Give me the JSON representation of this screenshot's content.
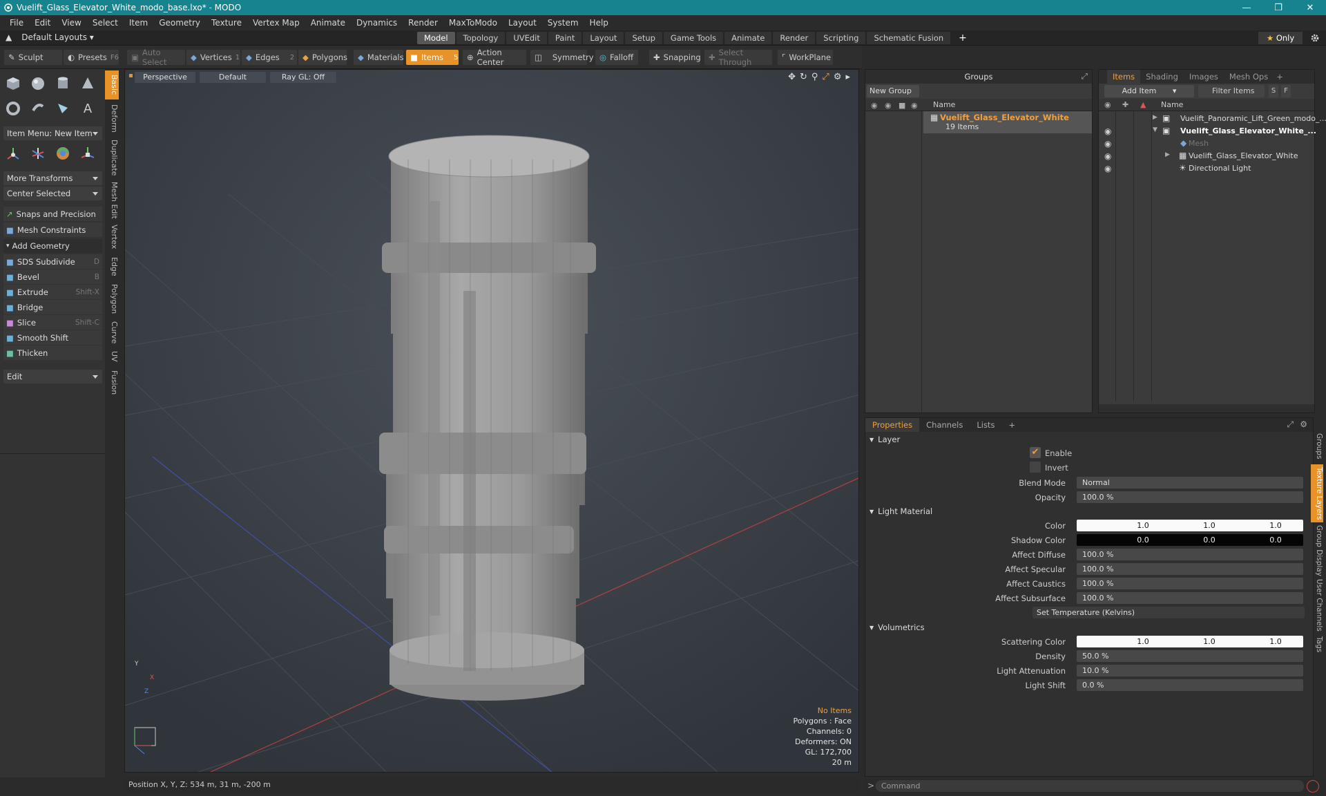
{
  "window": {
    "title": "Vuelift_Glass_Elevator_White_modo_base.lxo* - MODO"
  },
  "menu": [
    "File",
    "Edit",
    "View",
    "Select",
    "Item",
    "Geometry",
    "Texture",
    "Vertex Map",
    "Animate",
    "Dynamics",
    "Render",
    "MaxToModo",
    "Layout",
    "System",
    "Help"
  ],
  "layout": {
    "default_layouts": "Default Layouts",
    "tabs": [
      "Model",
      "Topology",
      "UVEdit",
      "Paint",
      "Layout",
      "Setup",
      "Game Tools",
      "Animate",
      "Render",
      "Scripting",
      "Schematic Fusion"
    ],
    "active_tab": "Model",
    "add": "+",
    "only": "Only"
  },
  "toolbar": {
    "sculpt": "Sculpt",
    "presets": "Presets",
    "presets_key": "F6",
    "auto_select": "Auto Select",
    "vertices": "Vertices",
    "vertices_key": "1",
    "edges": "Edges",
    "edges_key": "2",
    "polygons": "Polygons",
    "materials": "Materials",
    "items": "Items",
    "items_key": "5",
    "action_center": "Action Center",
    "symmetry": "Symmetry",
    "falloff": "Falloff",
    "snapping": "Snapping",
    "select_through": "Select Through",
    "workplane": "WorkPlane"
  },
  "toolbox": {
    "item_menu": "Item Menu: New Item",
    "more_transforms": "More Transforms",
    "center_selected": "Center Selected",
    "snaps": "Snaps and Precision",
    "mesh_constraints": "Mesh Constraints",
    "add_geometry": "Add Geometry",
    "tools": [
      {
        "label": "SDS Subdivide",
        "key": "D"
      },
      {
        "label": "Bevel",
        "key": "B"
      },
      {
        "label": "Extrude",
        "key": "Shift-X"
      },
      {
        "label": "Bridge",
        "key": ""
      },
      {
        "label": "Slice",
        "key": "Shift-C"
      },
      {
        "label": "Smooth Shift",
        "key": ""
      },
      {
        "label": "Thicken",
        "key": ""
      }
    ],
    "edit": "Edit",
    "vtabs": [
      "Basic",
      "Deform",
      "Duplicate",
      "Mesh Edit",
      "Vertex",
      "Edge",
      "Polygon",
      "Curve",
      "UV",
      "Fusion"
    ]
  },
  "viewport": {
    "perspective": "Perspective",
    "default": "Default",
    "raygl": "Ray GL: Off",
    "info": {
      "no_items": "No Items",
      "polygons": "Polygons : Face",
      "channels": "Channels: 0",
      "deformers": "Deformers: ON",
      "gl": "GL: 172,700",
      "scale": "20 m"
    },
    "axes": {
      "y": "Y",
      "x": "X",
      "z": "Z"
    }
  },
  "status": {
    "position": "Position X, Y, Z:  534 m, 31 m, -200 m"
  },
  "groups": {
    "title": "Groups",
    "new_group": "New Group",
    "name_col": "Name",
    "row_name": "Vuelift_Glass_Elevator_White",
    "row_count": "19 Items"
  },
  "items": {
    "tabs": [
      "Items",
      "Shading",
      "Images",
      "Mesh Ops"
    ],
    "add_tab": "+",
    "add_item": "Add Item",
    "filter": "Filter Items",
    "s": "S",
    "f": "F",
    "name_col": "Name",
    "rows": [
      "Vuelift_Panoramic_Lift_Green_modo_...",
      "Vuelift_Glass_Elevator_White_...",
      "Mesh",
      "Vuelift_Glass_Elevator_White",
      "Directional Light"
    ]
  },
  "properties": {
    "tabs": [
      "Properties",
      "Channels",
      "Lists"
    ],
    "add_tab": "+",
    "layer": "Layer",
    "enable": "Enable",
    "invert": "Invert",
    "blend_mode_label": "Blend Mode",
    "blend_mode": "Normal",
    "opacity_label": "Opacity",
    "opacity": "100.0 %",
    "light_material": "Light Material",
    "color_label": "Color",
    "color": [
      "1.0",
      "1.0",
      "1.0"
    ],
    "shadow_label": "Shadow Color",
    "shadow": [
      "0.0",
      "0.0",
      "0.0"
    ],
    "affect_diffuse_label": "Affect Diffuse",
    "affect_diffuse": "100.0 %",
    "affect_specular_label": "Affect Specular",
    "affect_specular": "100.0 %",
    "affect_caustics_label": "Affect Caustics",
    "affect_caustics": "100.0 %",
    "affect_subsurface_label": "Affect Subsurface",
    "affect_subsurface": "100.0 %",
    "set_temp": "Set Temperature (Kelvins)",
    "volumetrics": "Volumetrics",
    "scatter_label": "Scattering Color",
    "scatter": [
      "1.0",
      "1.0",
      "1.0"
    ],
    "density_label": "Density",
    "density": "50.0 %",
    "atten_label": "Light Attenuation",
    "atten": "10.0 %",
    "shift_label": "Light Shift",
    "shift": "0.0 %",
    "side_tabs": [
      "Groups",
      "Texture Layers",
      "Group Display",
      "User Channels",
      "Tags"
    ]
  },
  "command": {
    "placeholder": "Command",
    "prompt": ">"
  },
  "colors": {
    "title_bar": "#16838f",
    "accent": "#e8922a"
  }
}
